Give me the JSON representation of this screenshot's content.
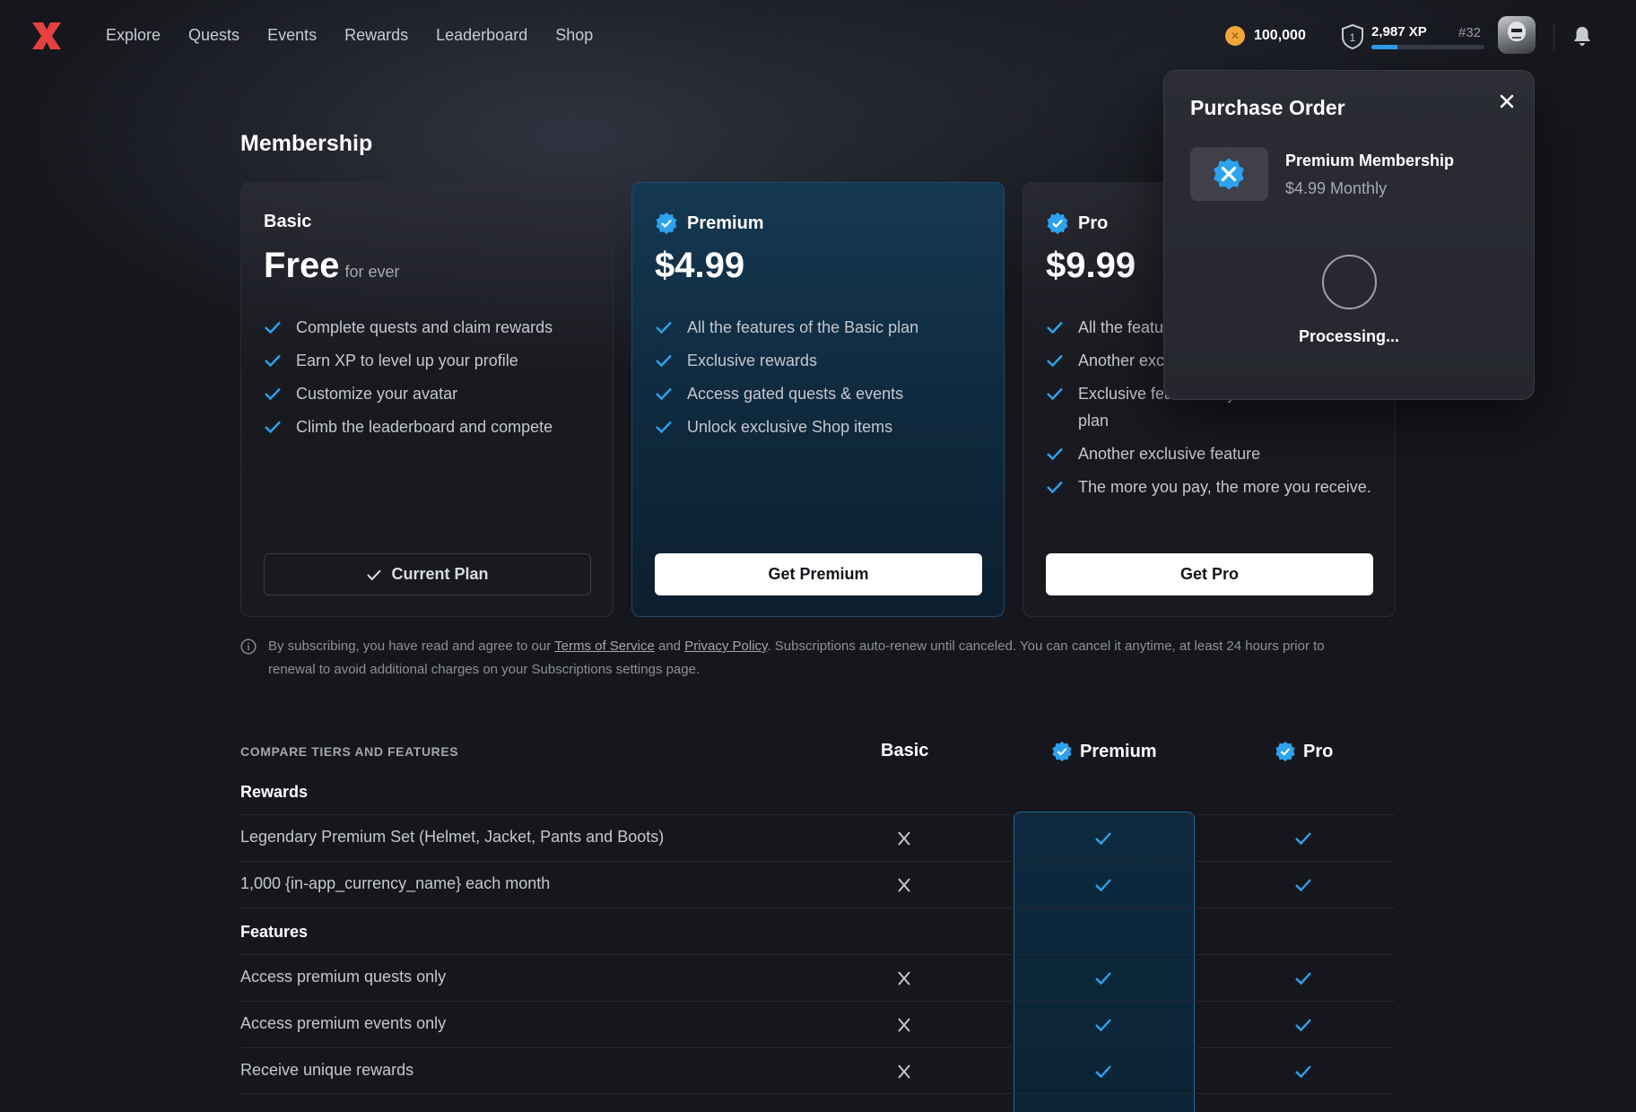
{
  "nav": {
    "links": [
      "Explore",
      "Quests",
      "Events",
      "Rewards",
      "Leaderboard",
      "Shop"
    ],
    "coins": "100,000",
    "xp": "2,987 XP",
    "xp_progress": 0.23,
    "level": "1",
    "rank": "#32"
  },
  "membership": {
    "title": "Membership",
    "plans": [
      {
        "name": "Basic",
        "price": "Free",
        "price_sub": "for ever",
        "features": [
          "Complete quests and claim rewards",
          "Earn XP to level up your profile",
          "Customize your avatar",
          "Climb the leaderboard and compete"
        ],
        "button": "Current Plan"
      },
      {
        "name": "Premium",
        "price": "$4.99",
        "features": [
          "All the features of the Basic plan",
          "Exclusive rewards",
          "Access gated quests & events",
          "Unlock exclusive Shop items"
        ],
        "button": "Get Premium"
      },
      {
        "name": "Pro",
        "price": "$9.99",
        "features": [
          "All the features of the Premium plan",
          "Another exclusive feature",
          "Exclusive feature only available in the Pro plan",
          "Another exclusive feature",
          "The more you pay, the more you receive."
        ],
        "button": "Get Pro"
      }
    ],
    "disclaimer": {
      "before": "By subscribing, you have read and agree to our ",
      "tos": "Terms of Service",
      "and": " and ",
      "privacy": "Privacy Policy",
      "after": ". Subscriptions auto-renew until canceled. You can cancel it anytime, at least 24 hours prior to renewal to avoid additional charges on your Subscriptions settings page."
    }
  },
  "compare": {
    "heading": "COMPARE TIERS AND FEATURES",
    "columns": [
      "Basic",
      "Premium",
      "Pro"
    ],
    "sections": [
      {
        "label": "Rewards",
        "rows": [
          {
            "label": "Legendary Premium Set (Helmet, Jacket, Pants and Boots)",
            "basic": false,
            "premium": true,
            "pro": true
          },
          {
            "label": "1,000 {in-app_currency_name} each month",
            "basic": false,
            "premium": true,
            "pro": true
          }
        ]
      },
      {
        "label": "Features",
        "rows": [
          {
            "label": "Access premium quests only",
            "basic": false,
            "premium": true,
            "pro": true
          },
          {
            "label": "Access premium events only",
            "basic": false,
            "premium": true,
            "pro": true
          },
          {
            "label": "Receive unique rewards",
            "basic": false,
            "premium": true,
            "pro": true
          }
        ]
      }
    ]
  },
  "modal": {
    "title": "Purchase Order",
    "item": "Premium Membership",
    "price": "$4.99 Monthly",
    "status": "Processing..."
  },
  "colors": {
    "accent": "#2da2ee",
    "logo": "#e5413f",
    "premium_bg": "#0f2a3f"
  }
}
